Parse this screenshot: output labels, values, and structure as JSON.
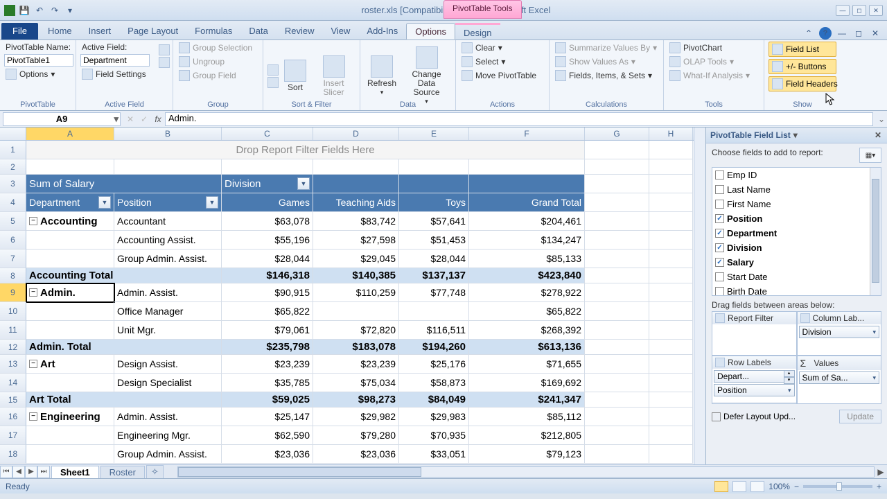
{
  "title": "roster.xls  [Compatibility Mode] - Microsoft Excel",
  "context_tab": "PivotTable Tools",
  "tabs": [
    "Home",
    "Insert",
    "Page Layout",
    "Formulas",
    "Data",
    "Review",
    "View",
    "Add-Ins",
    "Options",
    "Design"
  ],
  "ribbon": {
    "pt_name_label": "PivotTable Name:",
    "pt_name": "PivotTable1",
    "options_btn": "Options",
    "g1": "PivotTable",
    "active_field_label": "Active Field:",
    "active_field": "Department",
    "field_settings": "Field Settings",
    "g2": "Active Field",
    "group_sel": "Group Selection",
    "ungroup": "Ungroup",
    "group_field": "Group Field",
    "g3": "Group",
    "sort": "Sort",
    "insert_slicer": "Insert Slicer",
    "g4": "Sort & Filter",
    "refresh": "Refresh",
    "change_ds": "Change Data Source",
    "g5": "Data",
    "clear": "Clear",
    "select": "Select",
    "move_pt": "Move PivotTable",
    "g6": "Actions",
    "summarize": "Summarize Values By",
    "show_as": "Show Values As",
    "fields_items": "Fields, Items, & Sets",
    "g7": "Calculations",
    "pivotchart": "PivotChart",
    "olap": "OLAP Tools",
    "whatif": "What-If Analysis",
    "g8": "Tools",
    "fieldlist": "Field List",
    "pm_buttons": "+/- Buttons",
    "field_headers": "Field Headers",
    "g9": "Show"
  },
  "namebox": "A9",
  "formula": "Admin.",
  "cols": [
    "A",
    "B",
    "C",
    "D",
    "E",
    "F",
    "G",
    "H"
  ],
  "filter_placeholder": "Drop Report Filter Fields Here",
  "pivot": {
    "measure": "Sum of Salary",
    "colfield": "Division",
    "rowfields": [
      "Department",
      "Position"
    ],
    "colheads": [
      "Games",
      "Teaching Aids",
      "Toys",
      "Grand Total"
    ]
  },
  "rows": [
    {
      "r": 5,
      "dept": "Accounting",
      "pos": "Accountant",
      "v": [
        "$63,078",
        "$83,742",
        "$57,641",
        "$204,461"
      ],
      "expand": "−"
    },
    {
      "r": 6,
      "dept": "",
      "pos": "Accounting Assist.",
      "v": [
        "$55,196",
        "$27,598",
        "$51,453",
        "$134,247"
      ]
    },
    {
      "r": 7,
      "dept": "",
      "pos": "Group Admin. Assist.",
      "v": [
        "$28,044",
        "$29,045",
        "$28,044",
        "$85,133"
      ]
    },
    {
      "r": 8,
      "sub": "Accounting Total",
      "v": [
        "$146,318",
        "$140,385",
        "$137,137",
        "$423,840"
      ]
    },
    {
      "r": 9,
      "dept": "Admin.",
      "pos": "Admin. Assist.",
      "v": [
        "$90,915",
        "$110,259",
        "$77,748",
        "$278,922"
      ],
      "expand": "−",
      "sel": true
    },
    {
      "r": 10,
      "dept": "",
      "pos": "Office Manager",
      "v": [
        "$65,822",
        "",
        "",
        "$65,822"
      ]
    },
    {
      "r": 11,
      "dept": "",
      "pos": "Unit Mgr.",
      "v": [
        "$79,061",
        "$72,820",
        "$116,511",
        "$268,392"
      ]
    },
    {
      "r": 12,
      "sub": "Admin. Total",
      "v": [
        "$235,798",
        "$183,078",
        "$194,260",
        "$613,136"
      ]
    },
    {
      "r": 13,
      "dept": "Art",
      "pos": "Design Assist.",
      "v": [
        "$23,239",
        "$23,239",
        "$25,176",
        "$71,655"
      ],
      "expand": "−"
    },
    {
      "r": 14,
      "dept": "",
      "pos": "Design Specialist",
      "v": [
        "$35,785",
        "$75,034",
        "$58,873",
        "$169,692"
      ]
    },
    {
      "r": 15,
      "sub": "Art Total",
      "v": [
        "$59,025",
        "$98,273",
        "$84,049",
        "$241,347"
      ]
    },
    {
      "r": 16,
      "dept": "Engineering",
      "pos": "Admin. Assist.",
      "v": [
        "$25,147",
        "$29,982",
        "$29,983",
        "$85,112"
      ],
      "expand": "−"
    },
    {
      "r": 17,
      "dept": "",
      "pos": "Engineering Mgr.",
      "v": [
        "$62,590",
        "$79,280",
        "$70,935",
        "$212,805"
      ]
    },
    {
      "r": 18,
      "dept": "",
      "pos": "Group Admin. Assist.",
      "v": [
        "$23,036",
        "$23,036",
        "$33,051",
        "$79,123"
      ]
    }
  ],
  "fieldpane": {
    "title": "PivotTable Field List",
    "choose": "Choose fields to add to report:",
    "fields": [
      {
        "name": "Emp ID",
        "c": false
      },
      {
        "name": "Last Name",
        "c": false
      },
      {
        "name": "First Name",
        "c": false
      },
      {
        "name": "Position",
        "c": true
      },
      {
        "name": "Department",
        "c": true
      },
      {
        "name": "Division",
        "c": true
      },
      {
        "name": "Salary",
        "c": true
      },
      {
        "name": "Start Date",
        "c": false
      },
      {
        "name": "Birth Date",
        "c": false
      }
    ],
    "drag": "Drag fields between areas below:",
    "areas": {
      "filter": "Report Filter",
      "cols": "Column Lab...",
      "rows": "Row Labels",
      "vals": "Values"
    },
    "col_chip": "Division",
    "row_chip1": "Depart...",
    "row_chip2": "Position",
    "val_chip": "Sum of Sa...",
    "defer": "Defer Layout Upd...",
    "update": "Update"
  },
  "sheets": [
    "Sheet1",
    "Roster"
  ],
  "status": "Ready",
  "zoom": "100%"
}
